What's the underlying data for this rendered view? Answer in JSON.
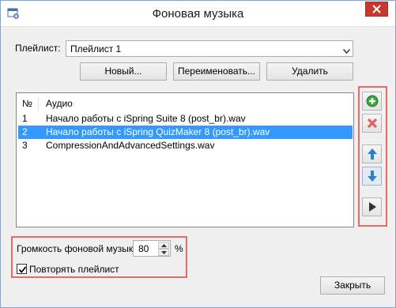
{
  "window": {
    "title": "Фоновая музыка"
  },
  "playlist": {
    "label": "Плейлист:",
    "selected": "Плейлист 1"
  },
  "buttons": {
    "new": "Новый...",
    "rename": "Переименовать...",
    "delete": "Удалить",
    "close": "Закрыть"
  },
  "table": {
    "columns": [
      "№",
      "Аудио"
    ],
    "rows": [
      {
        "num": "1",
        "name": "Начало работы с iSpring Suite 8 (post_br).wav",
        "selected": false
      },
      {
        "num": "2",
        "name": "Начало работы с iSpring QuizMaker 8 (post_br).wav",
        "selected": true
      },
      {
        "num": "3",
        "name": "CompressionAndAdvancedSettings.wav",
        "selected": false
      }
    ]
  },
  "side_toolbar": {
    "icons": [
      "add-icon",
      "remove-icon",
      "move-up-icon",
      "move-down-icon",
      "play-icon"
    ]
  },
  "volume": {
    "label": "Громкость фоновой музыки:",
    "value": "80",
    "unit": "%"
  },
  "repeat": {
    "label": "Повторять плейлист",
    "checked": true
  },
  "colors": {
    "selection": "#3399ff",
    "highlight_box": "#e56b6b",
    "close_button": "#c7392d",
    "add_green": "#3aa33a",
    "remove_red": "#e06060",
    "arrow_blue": "#2f7fd1"
  }
}
